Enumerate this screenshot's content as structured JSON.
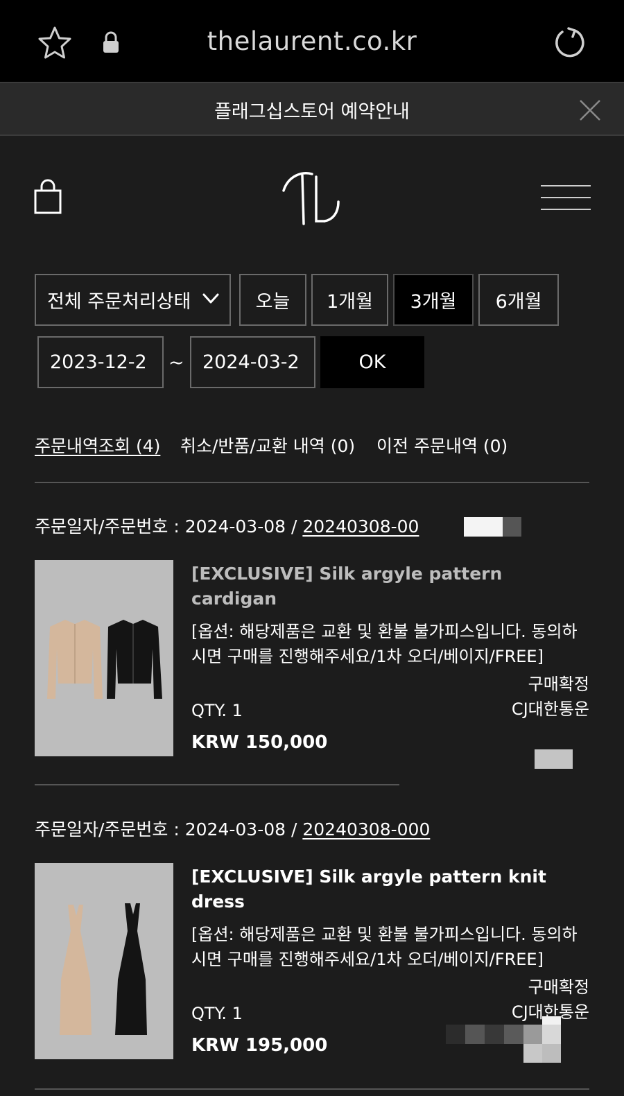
{
  "browser": {
    "url": "thelaurent.co.kr",
    "icons": [
      "star-icon",
      "lock-icon",
      "reload-icon"
    ]
  },
  "notice": {
    "text": "플래그십스토어 예약안내",
    "close_icon": "close-icon"
  },
  "header": {
    "icons": [
      "shopping-bag-icon",
      "brand-logo",
      "hamburger-menu-icon"
    ]
  },
  "filters": {
    "status_select": "전체 주문처리상태",
    "periods": [
      "오늘",
      "1개월",
      "3개월",
      "6개월"
    ],
    "selected_period": "3개월",
    "date_from": "2023-12-2",
    "date_separator": "~",
    "date_to": "2024-03-2",
    "ok_label": "OK"
  },
  "tabs": [
    {
      "label": "주문내역조회 (4)",
      "active": true
    },
    {
      "label": "취소/반품/교환 내역 (0)",
      "active": false
    },
    {
      "label": "이전 주문내역 (0)",
      "active": false
    }
  ],
  "orders": [
    {
      "date_label": "주문일자/주문번호 : 2024-03-08 / ",
      "order_no": "20240308-00",
      "product": {
        "title": "[EXCLUSIVE] Silk argyle pattern cardigan",
        "option": "[옵션: 해당제품은 교환 및 환불 불가피스입니다. 동의하시면 구매를 진행해주세요/1차 오더/베이지/FREE]",
        "qty": "QTY. 1",
        "price": "KRW 150,000",
        "status": "구매확정",
        "carrier": "CJ대한통운"
      }
    },
    {
      "date_label": "주문일자/주문번호 : 2024-03-08 / ",
      "order_no": "20240308-000",
      "product": {
        "title": "[EXCLUSIVE] Silk argyle pattern knit dress",
        "option": "[옵션: 해당제품은 교환 및 환불 불가피스입니다. 동의하시면 구매를 진행해주세요/1차 오더/베이지/FREE]",
        "qty": "QTY. 1",
        "price": "KRW 195,000",
        "status": "구매확정",
        "carrier": "CJ대한통운"
      }
    }
  ],
  "colors": {
    "page_bg": "#1c1c1c",
    "browser_bar": "#000000",
    "notice_bg": "#2a2a2a",
    "selected_button": "#000000",
    "thumb_bg": "#bdbdbd"
  }
}
